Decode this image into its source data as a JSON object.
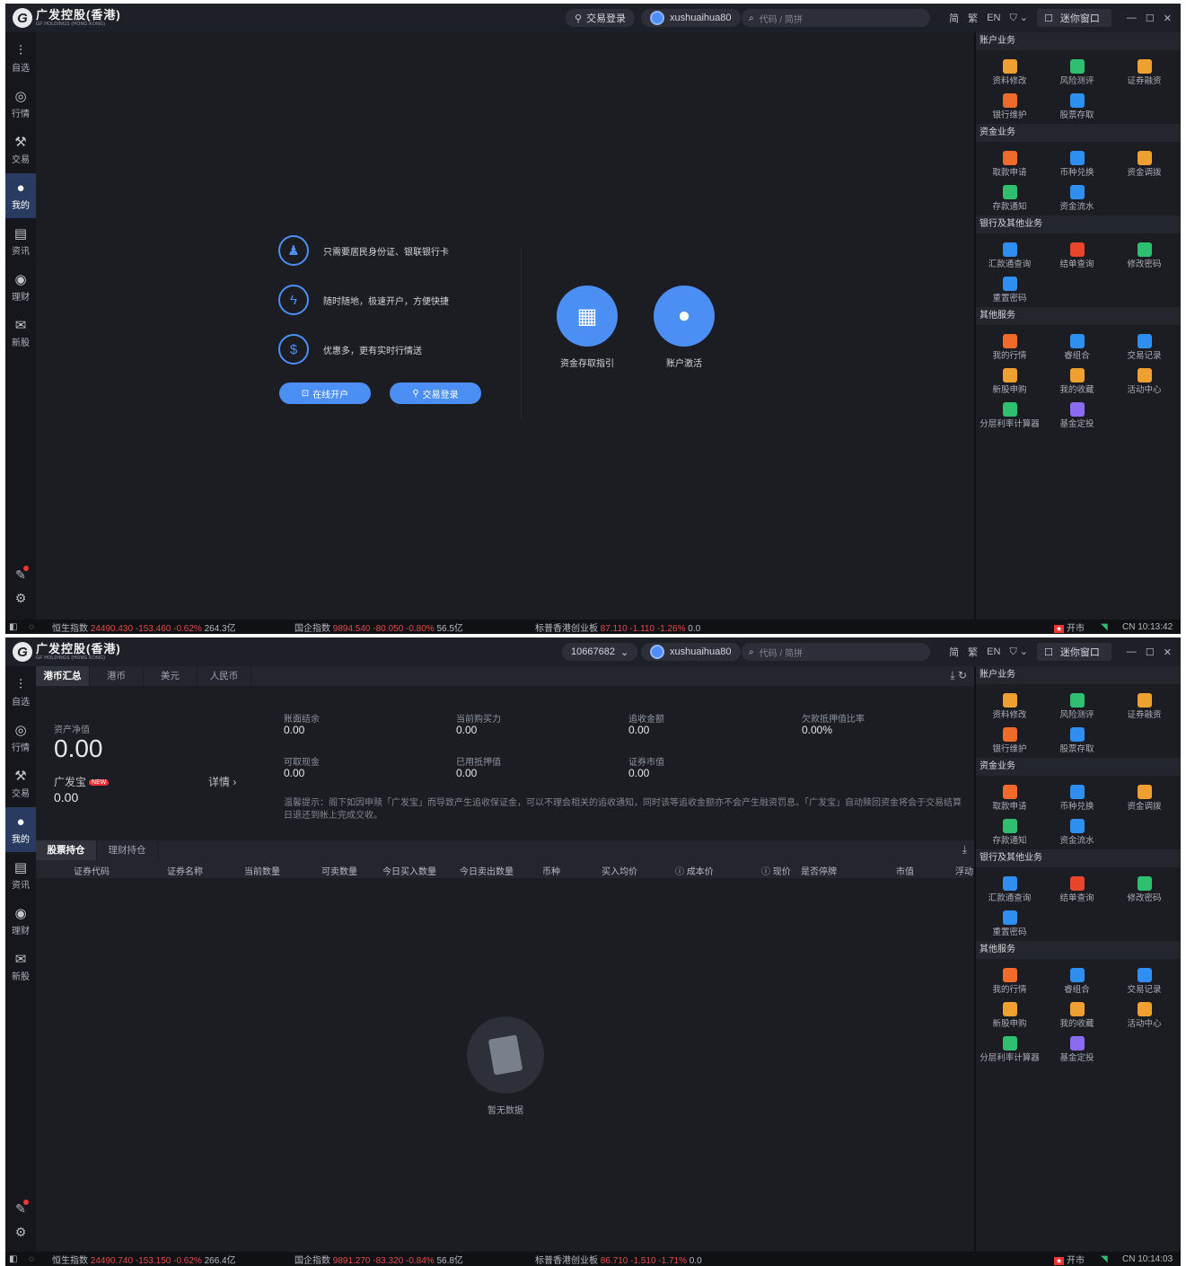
{
  "app": {
    "logo_mark": "G",
    "name_cn": "广发控股(香港)",
    "name_en": "GF HOLDINGS (HONG KONG)"
  },
  "window1": {
    "titlebar": {
      "login_label": "交易登录",
      "username": "xushuaihua80",
      "search_placeholder": "代码 / 简拼",
      "lang": "EN",
      "mini_window": "迷你窗口"
    },
    "promo": {
      "features": [
        "只需要居民身份证、银联银行卡",
        "随时随地，极速开户，方便快捷",
        "优惠多，更有实时行情送"
      ],
      "open_account": "在线开户",
      "trade_login": "交易登录",
      "guide": "资金存取指引",
      "activate": "账户激活"
    },
    "status": {
      "hsi": {
        "name": "恒生指数",
        "value": "24490.430",
        "change": "-153.460",
        "pct": "-0.62%",
        "turnover": "264.3亿"
      },
      "hscei": {
        "name": "国企指数",
        "value": "9894.540",
        "change": "-80.050",
        "pct": "-0.80%",
        "turnover": "56.5亿"
      },
      "gem": {
        "name": "标普香港创业板",
        "value": "87.110",
        "change": "-1.110",
        "pct": "-1.26%",
        "turnover": "0.0"
      },
      "market": "开市",
      "clock": "CN 10:13:42"
    }
  },
  "window2": {
    "titlebar": {
      "account": "10667682",
      "username": "xushuaihua80",
      "search_placeholder": "代码 / 简拼",
      "lang": "EN",
      "mini_window": "迷你窗口"
    },
    "tabs": [
      "港币汇总",
      "港币",
      "美元",
      "人民币"
    ],
    "summary": {
      "net_asset_label": "资产净值",
      "net_asset": "0.00",
      "gfb_label": "广发宝",
      "new_badge": "NEW",
      "gfb_value": "0.00",
      "detail": "详情 ›",
      "fields": [
        {
          "label": "账面结余",
          "value": "0.00"
        },
        {
          "label": "当前购买力",
          "value": "0.00"
        },
        {
          "label": "追收金额",
          "value": "0.00"
        },
        {
          "label": "欠款抵押值比率",
          "value": "0.00%"
        },
        {
          "label": "可取现金",
          "value": "0.00"
        },
        {
          "label": "已用抵押值",
          "value": "0.00"
        },
        {
          "label": "证券市值",
          "value": "0.00"
        }
      ],
      "tip": "温馨提示：阁下如因申赎「广发宝」而导致产生追收保证金，可以不理会相关的追收通知，同时该等追收金额亦不会产生融资罚息。「广发宝」自动赎回资金将会于交易结算日退还到帐上完成交收。"
    },
    "holdings_tabs": [
      "股票持仓",
      "理财持仓"
    ],
    "columns": [
      "证券代码",
      "证券名称",
      "当前数量",
      "可卖数量",
      "今日买入数量",
      "今日卖出数量",
      "币种",
      "买入均价",
      "ⓘ 成本价",
      "ⓘ 现价",
      "是否停牌",
      "市值",
      "浮动"
    ],
    "empty": "暂无数据",
    "status": {
      "hsi": {
        "name": "恒生指数",
        "value": "24490.740",
        "change": "-153.150",
        "pct": "-0.62%",
        "turnover": "266.4亿"
      },
      "hscei": {
        "name": "国企指数",
        "value": "9891.270",
        "change": "-83.320",
        "pct": "-0.84%",
        "turnover": "56.8亿"
      },
      "gem": {
        "name": "标普香港创业板",
        "value": "86.710",
        "change": "-1.510",
        "pct": "-1.71%",
        "turnover": "0.0"
      },
      "market": "开市",
      "clock": "CN 10:14:03"
    }
  },
  "nav": [
    "自选",
    "行情",
    "交易",
    "我的",
    "资讯",
    "理财",
    "新股"
  ],
  "services": [
    {
      "title": "账户业务",
      "items": [
        {
          "label": "资料修改",
          "color": "#f0a030"
        },
        {
          "label": "风险测评",
          "color": "#2fbf71"
        },
        {
          "label": "证券融资",
          "color": "#f0a030"
        },
        {
          "label": "银行维护",
          "color": "#f06a2a"
        },
        {
          "label": "股票存取",
          "color": "#2e8ff0"
        }
      ]
    },
    {
      "title": "资金业务",
      "items": [
        {
          "label": "取款申请",
          "color": "#f06a2a"
        },
        {
          "label": "币种兑换",
          "color": "#2e8ff0"
        },
        {
          "label": "资金调拨",
          "color": "#f0a030"
        },
        {
          "label": "存款通知",
          "color": "#2fbf71"
        },
        {
          "label": "资金流水",
          "color": "#2e8ff0"
        }
      ]
    },
    {
      "title": "银行及其他业务",
      "items": [
        {
          "label": "汇款通查询",
          "color": "#2e8ff0"
        },
        {
          "label": "结单查询",
          "color": "#e8452a"
        },
        {
          "label": "修改密码",
          "color": "#2fbf71"
        },
        {
          "label": "重置密码",
          "color": "#2e8ff0"
        }
      ]
    },
    {
      "title": "其他服务",
      "items": [
        {
          "label": "我的行情",
          "color": "#f06a2a"
        },
        {
          "label": "睿组合",
          "color": "#2e8ff0"
        },
        {
          "label": "交易记录",
          "color": "#2e8ff0"
        },
        {
          "label": "新股申购",
          "color": "#f0a030"
        },
        {
          "label": "我的收藏",
          "color": "#f0a030"
        },
        {
          "label": "活动中心",
          "color": "#f0a030"
        },
        {
          "label": "分层利率计算器",
          "color": "#2fbf71"
        },
        {
          "label": "基金定投",
          "color": "#8b6cf0"
        }
      ]
    }
  ]
}
